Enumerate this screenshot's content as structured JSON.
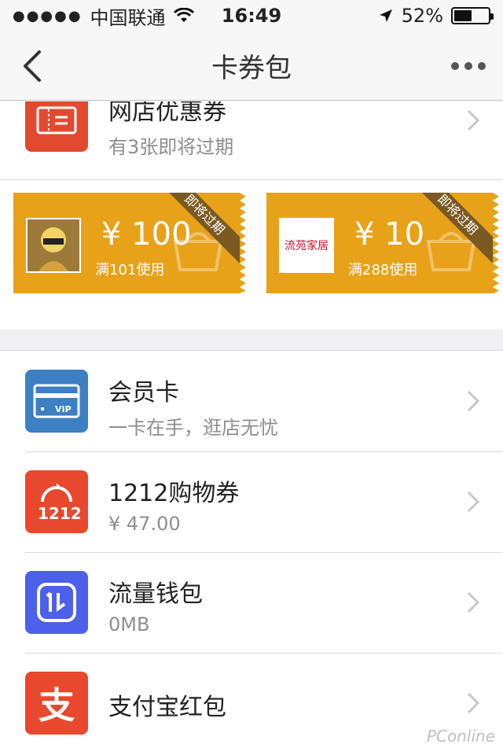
{
  "status_bar": {
    "carrier": "中国联通",
    "time": "16:49",
    "battery": "52%",
    "battery_level": 0.52
  },
  "nav": {
    "title": "卡券包"
  },
  "shop_coupons": {
    "title": "网店优惠券",
    "subtitle": "有3张即将过期"
  },
  "coupons": [
    {
      "amount": "¥ 100",
      "condition": "满101使用",
      "ribbon": "即将过期",
      "store_logo_text": ""
    },
    {
      "amount": "¥ 10",
      "condition": "满288使用",
      "ribbon": "即将过期",
      "store_logo_text": "流苑家居"
    }
  ],
  "list": [
    {
      "title": "会员卡",
      "subtitle": "一卡在手，逛店无忧",
      "icon": "vip-card-icon",
      "color": "#3d7fc3"
    },
    {
      "title": "1212购物券",
      "subtitle": "¥ 47.00",
      "icon": "1212-icon",
      "color": "#e8482c"
    },
    {
      "title": "流量钱包",
      "subtitle": "0MB",
      "icon": "data-wallet-icon",
      "color": "#4d60ea"
    },
    {
      "title": "支付宝红包",
      "subtitle": "",
      "icon": "alipay-redpacket-icon",
      "color": "#e8482c"
    }
  ],
  "watermark": "PConline"
}
